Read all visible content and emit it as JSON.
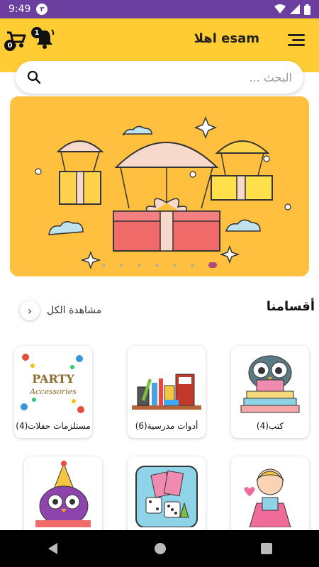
{
  "status": {
    "time": "9:49",
    "notif_badge": "٣"
  },
  "header": {
    "greeting": "اهلا esam",
    "cart_count": "0",
    "notif_count": "1"
  },
  "search": {
    "placeholder": "البحث ..."
  },
  "banner": {
    "dot_count": 7,
    "active_dot": 6
  },
  "section": {
    "title": "أقسامنا",
    "view_all": "مشاهدة الكل"
  },
  "categories": [
    {
      "label": "كتب(4)",
      "icon": "owl-books"
    },
    {
      "label": "أدوات مدرسية(6)",
      "icon": "school-supplies"
    },
    {
      "label": "مستلزمات حفلات(4)",
      "icon": "party-accessories"
    },
    {
      "label": "",
      "icon": "girl-gift"
    },
    {
      "label": "",
      "icon": "board-games"
    },
    {
      "label": "",
      "icon": "owl-party"
    }
  ],
  "colors": {
    "header": "#ffcc33",
    "status": "#6a3fa0",
    "banner": "#ffbf3f"
  }
}
